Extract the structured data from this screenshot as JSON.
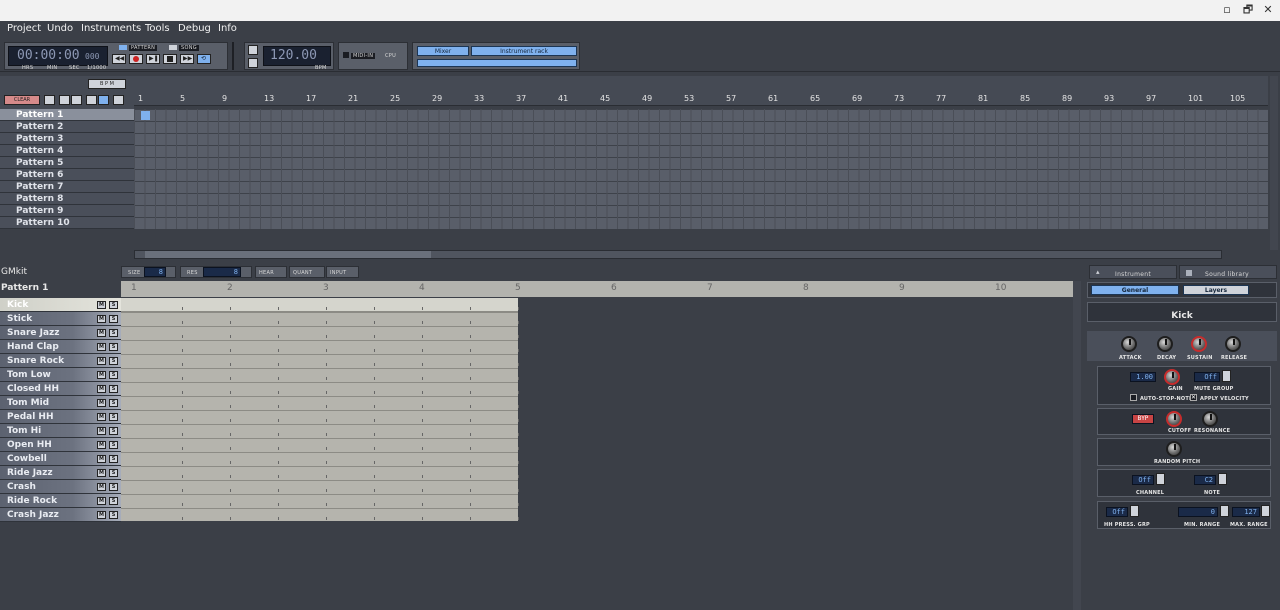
{
  "window": {
    "minimize": "▫",
    "maximize": "🗗",
    "close": "✕"
  },
  "menu": [
    "Project",
    "Undo",
    "Instruments",
    "Tools",
    "Debug",
    "Info"
  ],
  "transport": {
    "time": "00:00:00",
    "time_frac": "000",
    "time_labels": [
      "HRS",
      "MIN",
      "SEC",
      "1/1000"
    ],
    "mode_pattern": "PATTERN",
    "mode_song": "SONG",
    "bpm": "120.00",
    "bpm_label": "BPM",
    "midi_in": "MIDI-IN",
    "cpu": "CPU",
    "mixer": "Mixer",
    "instrument_rack": "Instrument rack"
  },
  "song_editor": {
    "button_bpm": "B P M",
    "clear": "CLEAR",
    "ruler": [
      "1",
      "5",
      "9",
      "13",
      "17",
      "21",
      "25",
      "29",
      "33",
      "37",
      "41",
      "45",
      "49",
      "53",
      "57",
      "61",
      "65",
      "69",
      "73",
      "77",
      "81",
      "85",
      "89",
      "93",
      "97",
      "101",
      "105"
    ],
    "patterns": [
      "Pattern 1",
      "Pattern 2",
      "Pattern 3",
      "Pattern 4",
      "Pattern 5",
      "Pattern 6",
      "Pattern 7",
      "Pattern 8",
      "Pattern 9",
      "Pattern 10"
    ]
  },
  "pattern_editor": {
    "drumkit": "GMkit",
    "size_label": "SIZE",
    "size_value": "8",
    "res_label": "RES",
    "res_value": "8",
    "hear": "HEAR",
    "quant": "QUANT",
    "input": "INPUT",
    "pattern_name": "Pattern 1",
    "ruler": [
      "1",
      "2",
      "3",
      "4",
      "5",
      "6",
      "7",
      "8",
      "9",
      "10"
    ],
    "instruments": [
      "Kick",
      "Stick",
      "Snare Jazz",
      "Hand Clap",
      "Snare Rock",
      "Tom Low",
      "Closed HH",
      "Tom Mid",
      "Pedal HH",
      "Tom Hi",
      "Open HH",
      "Cowbell",
      "Ride Jazz",
      "Crash",
      "Ride Rock",
      "Crash Jazz"
    ],
    "mute": "M",
    "solo": "S"
  },
  "instrument_panel": {
    "tab_instrument": "Instrument",
    "tab_library": "Sound library",
    "tab_general": "General",
    "tab_layers": "Layers",
    "name": "Kick",
    "adsr": [
      "ATTACK",
      "DECAY",
      "SUSTAIN",
      "RELEASE"
    ],
    "gain_value": "1.00",
    "gain_label": "GAIN",
    "mute_group_value": "Off",
    "mute_group_label": "MUTE GROUP",
    "auto_stop": "AUTO-STOP-NOTE",
    "apply_velocity": "APPLY VELOCITY",
    "byp": "BYP",
    "cutoff": "CUTOFF",
    "resonance": "RESONANCE",
    "random_pitch": "RANDOM PITCH",
    "channel_value": "Off",
    "channel_label": "CHANNEL",
    "note_value": "C2",
    "note_label": "NOTE",
    "hh_press_value": "Off",
    "hh_press_label": "HH PRESS. GRP",
    "min_range_value": "0",
    "min_range_label": "MIN. RANGE",
    "max_range_value": "127",
    "max_range_label": "MAX. RANGE"
  }
}
